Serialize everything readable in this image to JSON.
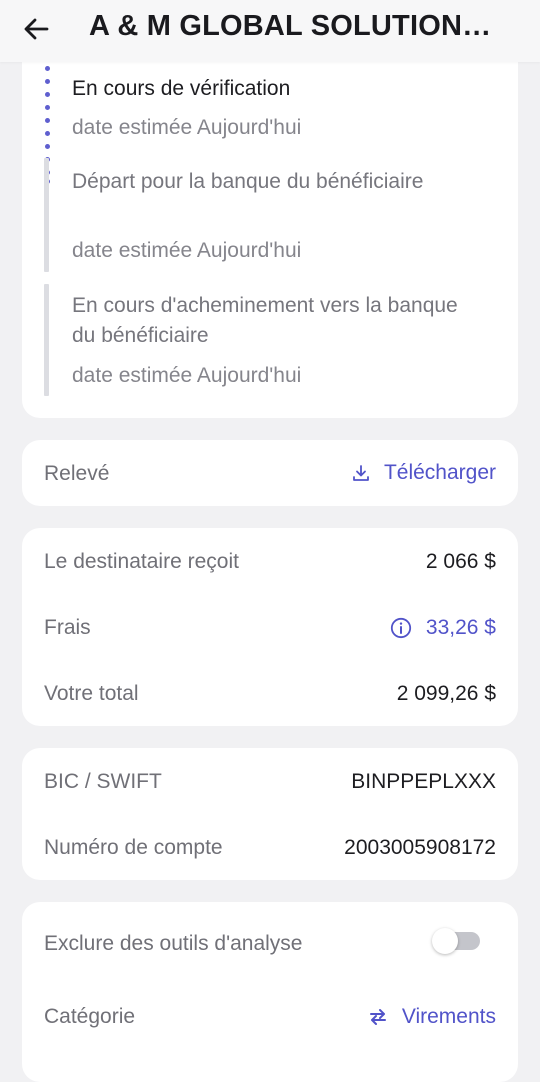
{
  "header": {
    "title": "A & M GLOBAL SOLUTIONS INTERNATIONAL"
  },
  "timeline": {
    "steps": [
      {
        "title": "En cours de vérification",
        "sub": "date estimée Aujourd'hui",
        "state": "active"
      },
      {
        "title": "Départ pour la banque du bénéficiaire",
        "sub": "date estimée Aujourd'hui",
        "state": "pending"
      },
      {
        "title": "En cours d'acheminement vers la banque du bénéficiaire",
        "sub": "date estimée Aujourd'hui",
        "state": "pending"
      }
    ]
  },
  "statement": {
    "label": "Relevé",
    "download_label": "Télécharger",
    "download_icon": "download-icon"
  },
  "amounts": {
    "recipient_label": "Le destinataire reçoit",
    "recipient_value": "2 066 $",
    "fees_label": "Frais",
    "fees_value": "33,26 $",
    "fees_icon": "info-icon",
    "total_label": "Votre total",
    "total_value": "2 099,26 $"
  },
  "bank": {
    "bic_label": "BIC / SWIFT",
    "bic_value": "BINPPEPLXXX",
    "account_label": "Numéro de compte",
    "account_value": "2003005908172"
  },
  "options": {
    "exclude_label": "Exclure des outils d'analyse",
    "exclude_enabled": false,
    "category_label": "Catégorie",
    "category_value": "Virements",
    "category_icon": "transfer-arrows-icon"
  },
  "colors": {
    "accent": "#5153c9",
    "background": "#f1f1f3",
    "card": "#ffffff"
  }
}
